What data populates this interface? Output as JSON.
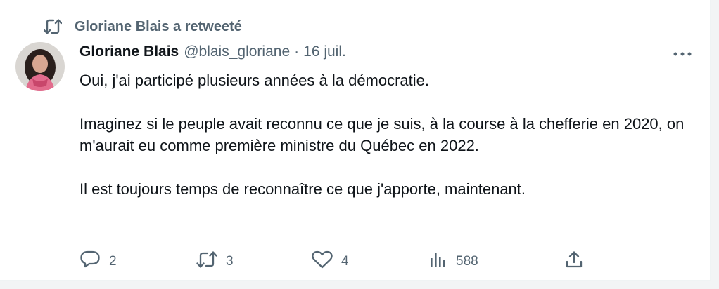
{
  "retweet": {
    "label": "Gloriane Blais a retweeté"
  },
  "tweet": {
    "author_name": "Gloriane Blais",
    "handle": "@blais_gloriane",
    "separator": "·",
    "date": "16 juil.",
    "paragraphs": [
      "Oui, j'ai participé plusieurs années à la démocratie.",
      "Imaginez si le peuple avait reconnu ce que je suis, à la course à la chefferie en 2020, on m'aurait eu comme première ministre du Québec en 2022.",
      "Il est toujours temps de reconnaître ce que j'apporte, maintenant."
    ]
  },
  "actions": {
    "reply": {
      "icon": "reply-icon",
      "count": "2"
    },
    "retweet": {
      "icon": "retweet-icon",
      "count": "3"
    },
    "like": {
      "icon": "heart-icon",
      "count": "4"
    },
    "views": {
      "icon": "views-icon",
      "count": "588"
    },
    "share": {
      "icon": "share-icon"
    }
  },
  "colors": {
    "text_primary": "#0f1419",
    "text_secondary": "#536471",
    "background": "#ffffff"
  }
}
